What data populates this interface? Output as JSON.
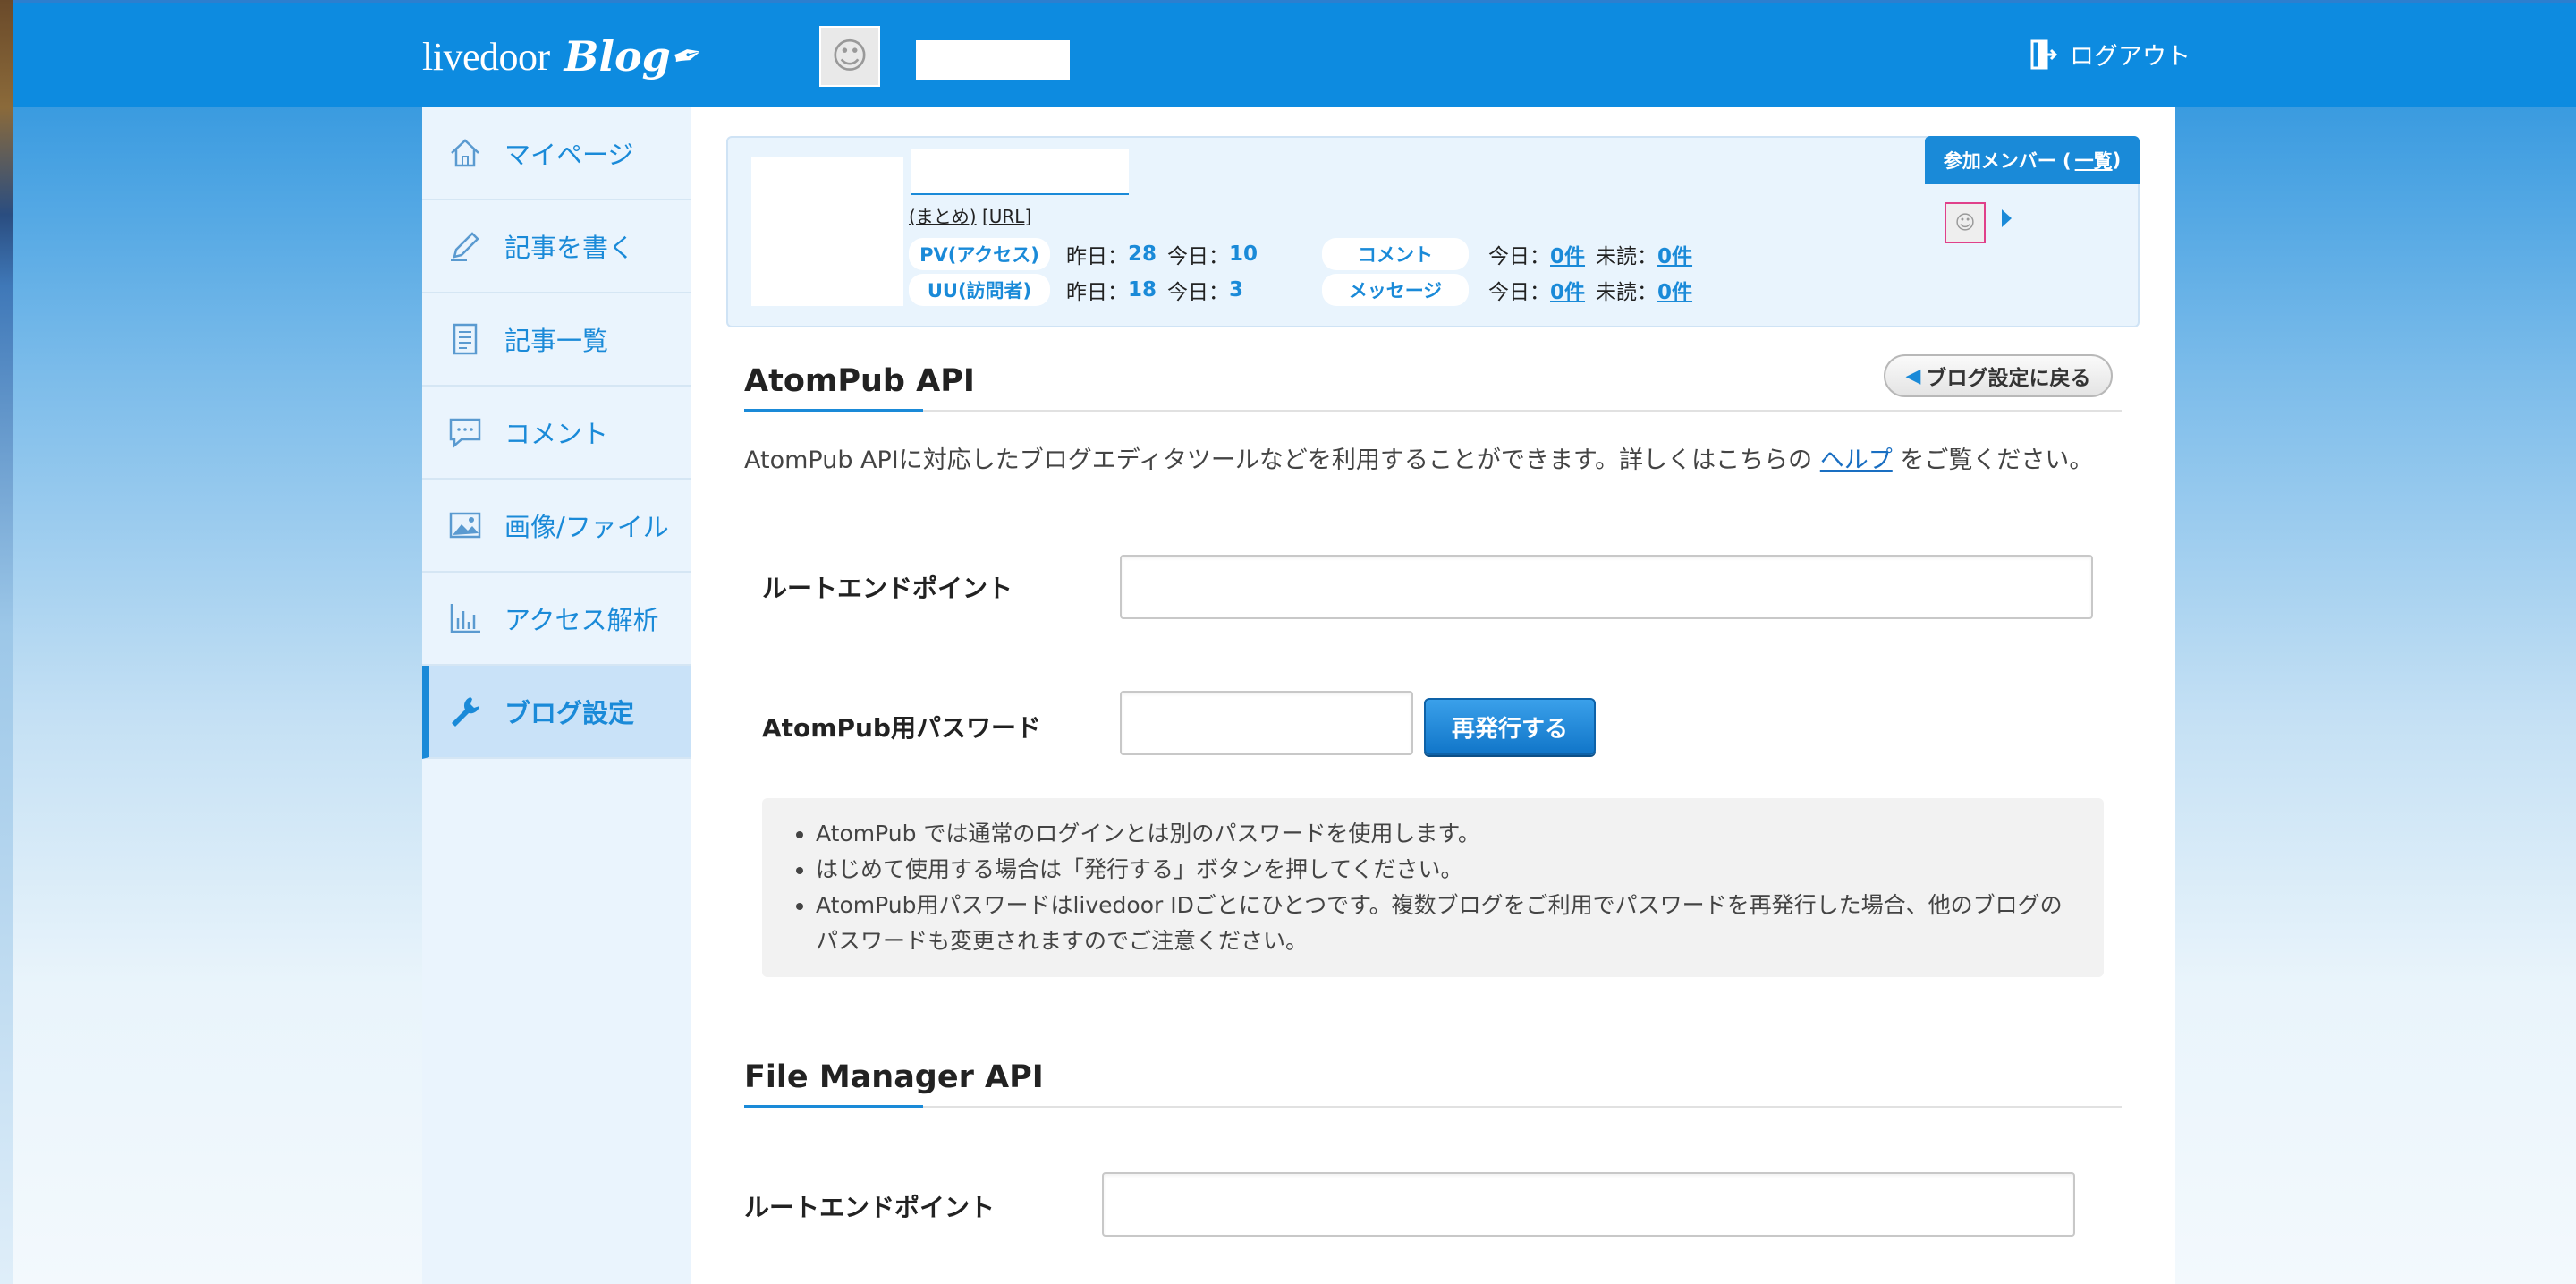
{
  "header": {
    "logo_text": "livedoor",
    "logo_blog": "Blog",
    "logout_label": "ログアウト"
  },
  "sidebar": {
    "items": [
      {
        "label": "マイページ",
        "icon": "home-icon"
      },
      {
        "label": "記事を書く",
        "icon": "pen-icon"
      },
      {
        "label": "記事一覧",
        "icon": "document-list-icon"
      },
      {
        "label": "コメント",
        "icon": "comment-icon"
      },
      {
        "label": "画像/ファイル",
        "icon": "image-icon"
      },
      {
        "label": "アクセス解析",
        "icon": "bar-chart-icon"
      },
      {
        "label": "ブログ設定",
        "icon": "wrench-icon",
        "active": true
      }
    ]
  },
  "blog_info": {
    "links_matome": "(まとめ)",
    "links_url": "[URL]",
    "pv_label": "PV(アクセス)",
    "uu_label": "UU(訪問者)",
    "comment_label": "コメント",
    "message_label": "メッセージ",
    "yesterday_label": "昨日：",
    "today_label": "今日：",
    "unread_label": "未読：",
    "pv_yesterday": "28",
    "pv_today": "10",
    "uu_yesterday": "18",
    "uu_today": "3",
    "comment_today": "0件",
    "comment_unread": "0件",
    "message_today": "0件",
    "message_unread": "0件",
    "members_label": "参加メンバー (",
    "members_list_link": "一覧",
    "members_close": ")"
  },
  "atompub": {
    "title": "AtomPub API",
    "back_button": "ブログ設定に戻る",
    "desc_before": "AtomPub APIに対応したブログエディタツールなどを利用することができます。詳しくはこちらの",
    "desc_link": "ヘルプ",
    "desc_after": "をご覧ください。",
    "root_endpoint_label": "ルートエンドポイント",
    "password_label": "AtomPub用パスワード",
    "reissue_button": "再発行する",
    "notes": [
      "AtomPub では通常のログインとは別のパスワードを使用します。",
      "はじめて使用する場合は「発行する」ボタンを押してください。",
      "AtomPub用パスワードはlivedoor IDごとにひとつです。複数ブログをご利用でパスワードを再発行した場合、他のブログのパスワードも変更されますのでご注意ください。"
    ]
  },
  "filemanager": {
    "title": "File Manager API",
    "root_endpoint_label": "ルートエンドポイント"
  }
}
